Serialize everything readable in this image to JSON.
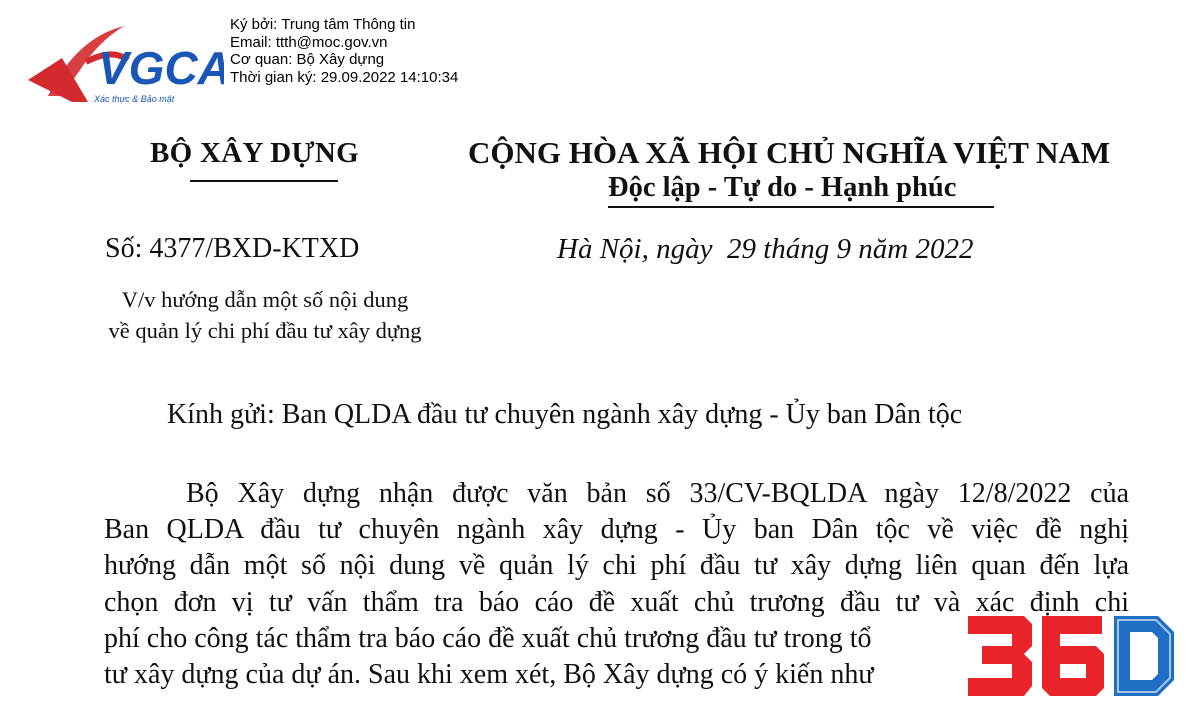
{
  "signature": {
    "logo_text": "VGCA",
    "logo_tagline": "Xác thực & Bảo mật",
    "signed_by": "Ký bởi: Trung tâm Thông tin",
    "email": "Email: ttth@moc.gov.vn",
    "agency": "Cơ quan: Bộ Xây dựng",
    "signed_time": "Thời gian ký: 29.09.2022 14:10:34"
  },
  "header": {
    "agency_name": "BỘ XÂY DỰNG",
    "nation": "CỘNG HÒA XÃ HỘI CHỦ NGHĨA VIỆT NAM",
    "motto": "Độc lập - Tự do - Hạnh phúc",
    "doc_number": "Số: 4377/BXD-KTXD",
    "place_date": "Hà Nội, ngày  29 tháng 9 năm 2022",
    "subject_lines": [
      "V/v hướng dẫn một số nội dung",
      "về quản lý chi phí đầu tư xây dựng"
    ]
  },
  "recipient": "Kính gửi: Ban QLDA đầu tư chuyên ngành xây dựng - Ủy ban Dân tộc",
  "body_lines": [
    "Bộ Xây dựng nhận được văn bản số 33/CV-BQLDA ngày 12/8/2022 của",
    "Ban QLDA đầu tư chuyên ngành xây dựng - Ủy ban Dân tộc về việc đề nghị",
    "hướng dẫn một số nội dung về quản lý chi phí đầu tư xây dựng liên quan đến lựa",
    "chọn đơn vị tư vấn thẩm tra báo cáo đề xuất chủ trương đầu tư và xác định chi",
    "phí cho công tác thẩm tra báo cáo đề xuất chủ trương đầu tư trong tổ",
    "tư xây dựng của dự án. Sau khi xem xét, Bộ Xây dựng có ý kiến như"
  ],
  "watermark": "360",
  "colors": {
    "logo_red": "#d32a2f",
    "logo_blue": "#1a56b8",
    "watermark_red": "#e8242a",
    "watermark_blue": "#1f6fc6"
  }
}
